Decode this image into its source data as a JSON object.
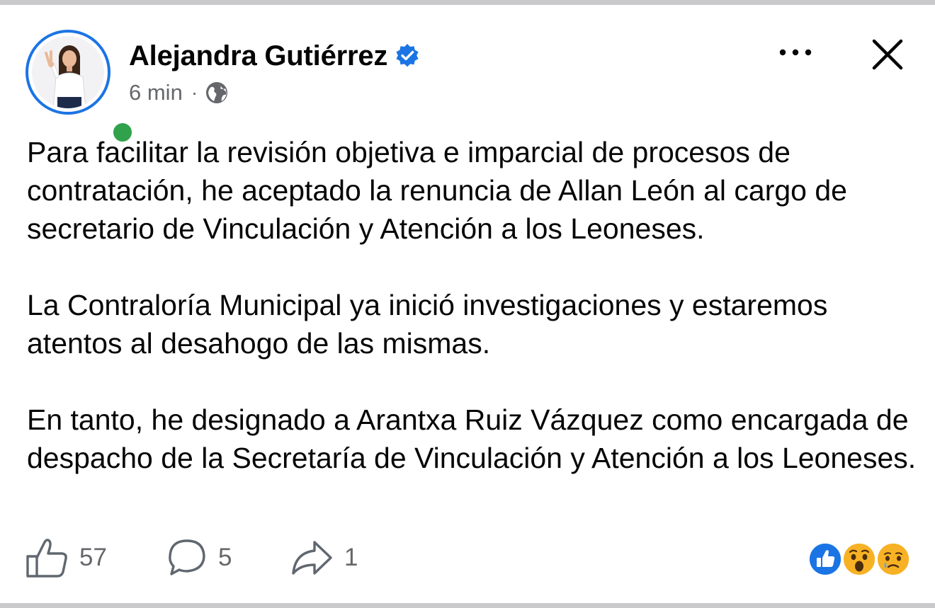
{
  "post": {
    "author_name": "Alejandra Gutiérrez",
    "verified": true,
    "time": "6 min",
    "separator": "·",
    "audience_icon": "globe-icon",
    "paragraphs": [
      "Para facilitar la revisión objetiva e imparcial de procesos de contratación, he aceptado la renuncia de Allan León al cargo de secretario de Vinculación y Atención a los Leoneses.",
      "La Contraloría Municipal ya inició investigaciones y estaremos atentos al desahogo de las mismas.",
      "En tanto, he designado a Arantxa Ruiz Vázquez como encargada de despacho de la Secretaría de Vinculación y Atención a los Leoneses."
    ]
  },
  "footer": {
    "likes": "57",
    "comments": "5",
    "shares": "1",
    "reactions": [
      "like",
      "wow",
      "sad"
    ]
  },
  "icons": {
    "more": "more-dots-icon",
    "close": "close-icon",
    "like": "thumbs-up-icon",
    "comment": "comment-bubble-icon",
    "share": "share-arrow-icon"
  },
  "colors": {
    "brand_blue": "#1b74e4",
    "online_green": "#31a24c",
    "secondary_text": "#65676b",
    "primary_text": "#050505",
    "reaction_yellow": "#f7b125"
  }
}
